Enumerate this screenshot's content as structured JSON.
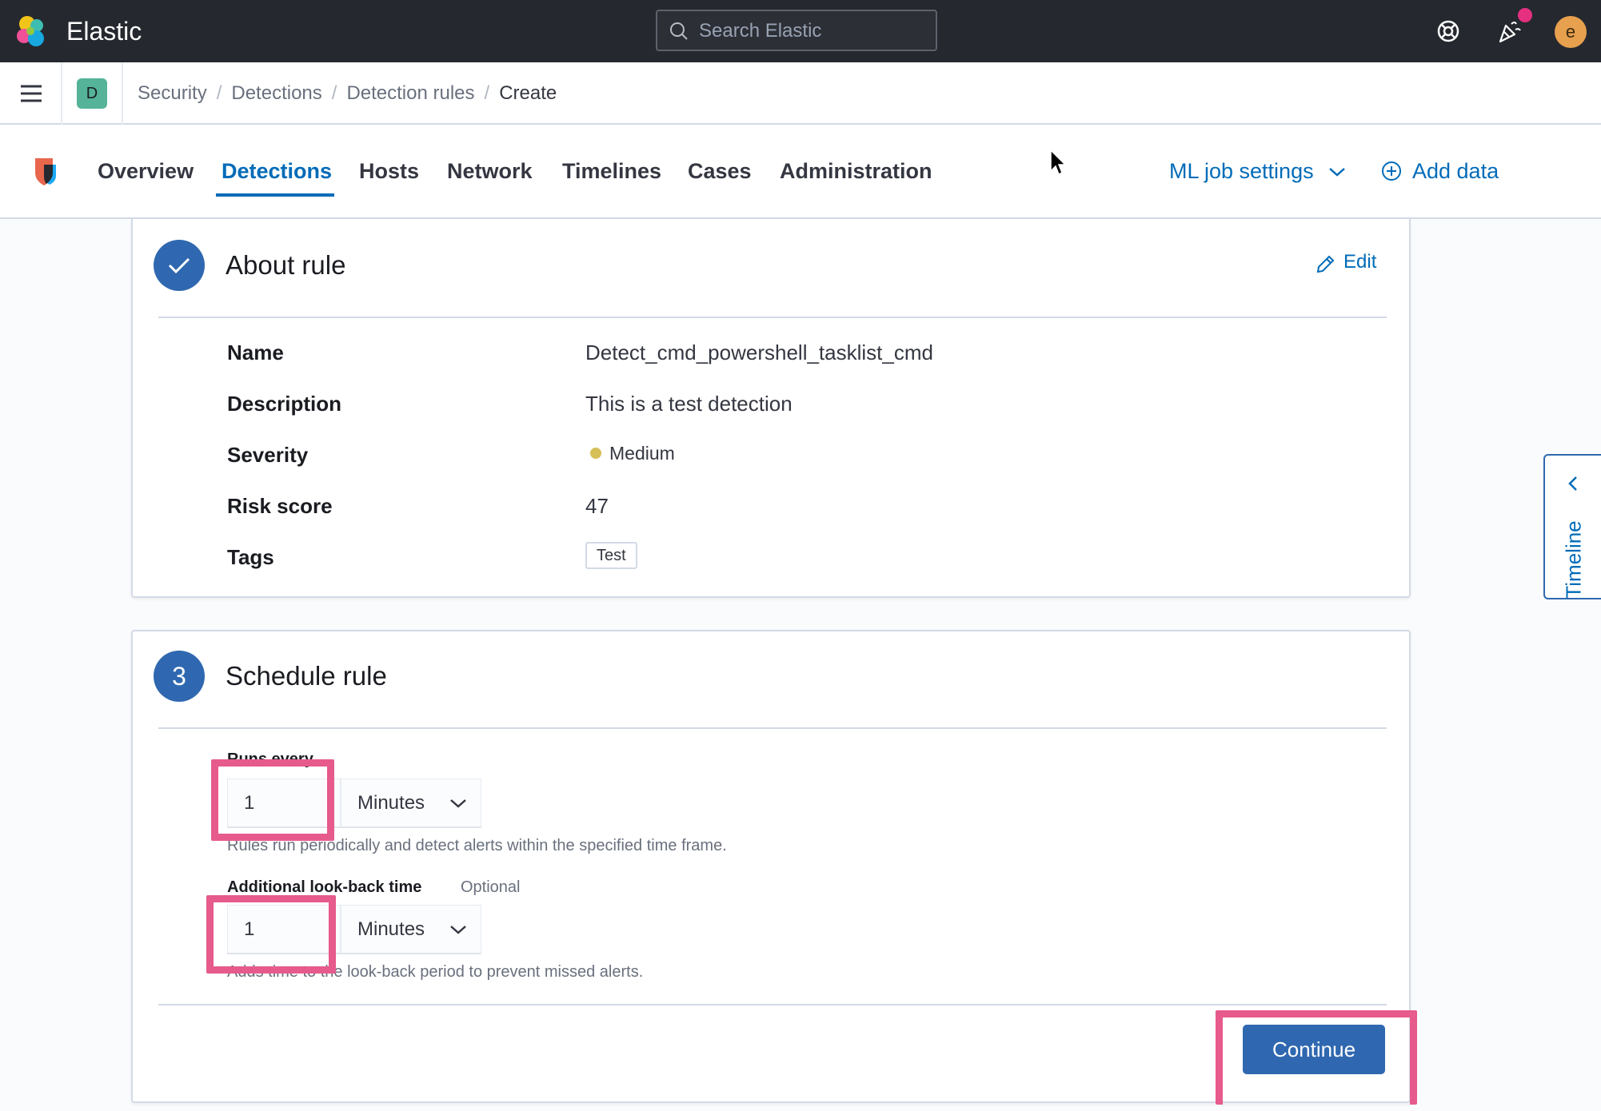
{
  "header": {
    "brand": "Elastic",
    "search_placeholder": "Search Elastic",
    "avatar_initial": "e",
    "icons": [
      "help-icon",
      "newsfeed-icon"
    ]
  },
  "breadcrumb": {
    "space_initial": "D",
    "items": [
      "Security",
      "Detections",
      "Detection rules",
      "Create"
    ]
  },
  "appnav": {
    "tabs": [
      "Overview",
      "Detections",
      "Hosts",
      "Network",
      "Timelines",
      "Cases",
      "Administration"
    ],
    "active_tab": "Detections",
    "ml_job_settings": "ML job settings",
    "add_data": "Add data"
  },
  "about_rule": {
    "title": "About rule",
    "edit_label": "Edit",
    "fields": [
      {
        "label": "Name",
        "value": "Detect_cmd_powershell_tasklist_cmd"
      },
      {
        "label": "Description",
        "value": "This is a test detection"
      },
      {
        "label": "Severity",
        "value": "Medium"
      },
      {
        "label": "Risk score",
        "value": "47"
      },
      {
        "label": "Tags",
        "value": "Test"
      }
    ],
    "severity_color": "#d6bf57"
  },
  "schedule_rule": {
    "step_number": "3",
    "title": "Schedule rule",
    "runs_every": {
      "label": "Runs every",
      "value": "1",
      "unit": "Minutes",
      "help": "Rules run periodically and detect alerts within the specified time frame."
    },
    "lookback": {
      "label": "Additional look-back time",
      "optional": "Optional",
      "value": "1",
      "unit": "Minutes",
      "help": "Adds time to the look-back period to prevent missed alerts."
    },
    "continue_label": "Continue"
  },
  "timeline_flyout": {
    "label": "Timeline"
  },
  "colors": {
    "header_bg": "#25282f",
    "accent": "#006bb8",
    "primary_button": "#2f68b0",
    "highlight": "#e65a8c"
  }
}
